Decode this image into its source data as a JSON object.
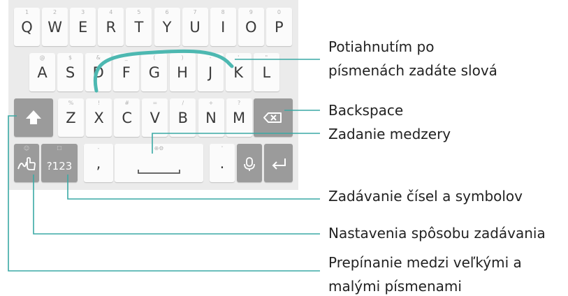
{
  "keyboard": {
    "row1": [
      {
        "label": "Q",
        "hint": "1"
      },
      {
        "label": "W",
        "hint": "2"
      },
      {
        "label": "E",
        "hint": "3"
      },
      {
        "label": "R",
        "hint": "4"
      },
      {
        "label": "T",
        "hint": "5"
      },
      {
        "label": "Y",
        "hint": "6"
      },
      {
        "label": "U",
        "hint": "7"
      },
      {
        "label": "I",
        "hint": "8"
      },
      {
        "label": "O",
        "hint": "9"
      },
      {
        "label": "P",
        "hint": "0"
      }
    ],
    "row2": [
      {
        "label": "A",
        "hint": "@"
      },
      {
        "label": "S",
        "hint": "$"
      },
      {
        "label": "D",
        "hint": "&"
      },
      {
        "label": "F",
        "hint": "_"
      },
      {
        "label": "G",
        "hint": "("
      },
      {
        "label": "H",
        "hint": ")"
      },
      {
        "label": "J",
        "hint": "-"
      },
      {
        "label": "K",
        "hint": "'"
      },
      {
        "label": "L",
        "hint": "\""
      }
    ],
    "row3": [
      {
        "label": "Z",
        "hint": "%"
      },
      {
        "label": "X",
        "hint": "!"
      },
      {
        "label": "C",
        "hint": "#"
      },
      {
        "label": "V",
        "hint": "="
      },
      {
        "label": "B",
        "hint": "/"
      },
      {
        "label": "N",
        "hint": "+"
      },
      {
        "label": "M",
        "hint": "?"
      }
    ],
    "symbols_key": "?123",
    "comma_key": ",",
    "period_key": ".",
    "comma_hint": "-",
    "period_hint": "'"
  },
  "callouts": {
    "swipe_line1": "Potiahnutím po",
    "swipe_line2": "písmenách zadáte slová",
    "backspace": "Backspace",
    "space": "Zadanie medzery",
    "numbers": "Zadávanie čísel a symbolov",
    "settings": "Nastavenia spôsobu zadávania",
    "shift_line1": "Prepínanie medzi veľkými a",
    "shift_line2": "malými písmenami"
  },
  "colors": {
    "callout_line": "#3aa9a5",
    "swipe_trail": "#4db8b1",
    "keyboard_bg": "#ebebeb",
    "key_bg": "#fbfbfb",
    "function_key_bg": "#9b9b9b"
  }
}
